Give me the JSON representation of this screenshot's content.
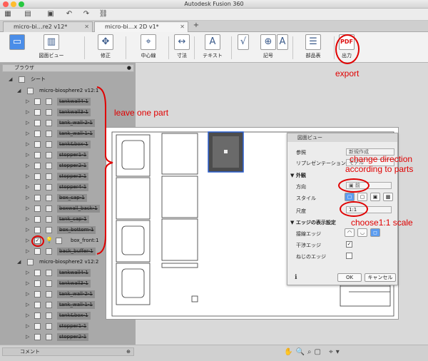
{
  "app": {
    "title": "Autodesk Fusion 360"
  },
  "tabs": [
    {
      "label": "micro-bi…re2 v12*"
    },
    {
      "label": "micro-bi…x 2D v1*"
    }
  ],
  "toolbar": {
    "drawing_view": "図面ビュー",
    "modify": "修正",
    "centerline": "中心線",
    "dimension": "寸法",
    "text": "テキスト",
    "symbol": "記号",
    "parts_list": "部品表",
    "output": "出力"
  },
  "browser": {
    "title": "ブラウザ",
    "sheet": "シート",
    "doc1": "micro-biosphere2 v12:1",
    "doc2": "micro-biosphere2 v12:2",
    "items1": [
      "tankwall4-1",
      "tankwall3-1",
      "tank_wall-2-1",
      "tank_wall-1-1",
      "tank&box-1",
      "stopper1-1",
      "stopper2-1",
      "stopper3-1",
      "stopper4-1",
      "box_cap-1",
      "boxwall_back-1",
      "tank_cap-1",
      "box_bottom-1",
      "box_front:1",
      "back_buffer-1"
    ],
    "items2": [
      "tankwall4-1",
      "tankwall3-1",
      "tank_wall-2-1",
      "tank_wall-1-1",
      "tank&box-1",
      "stopper1-1",
      "stopper2-1"
    ]
  },
  "dialog": {
    "title": "図面ビュー",
    "reference_label": "参照",
    "reference_value": "新規作成",
    "representation_label": "リプレゼンテーション",
    "representation_value": "モデル",
    "appearance_header": "外観",
    "direction_label": "方向",
    "direction_value": "前",
    "style_label": "スタイル",
    "scale_label": "尺度",
    "scale_value": "1:1",
    "edge_header": "エッジの表示設定",
    "tangent_label": "接線エッジ",
    "interference_label": "干渉エッジ",
    "thread_label": "ねじのエッジ",
    "ok": "OK",
    "cancel": "キャンセル"
  },
  "annotations": {
    "export": "export",
    "leave": "leave one part",
    "direction1": "change direction",
    "direction2": "according to parts",
    "scale": "choose1:1 scale"
  },
  "bottom": {
    "comment": "コメント"
  },
  "colors": {
    "annotation": "#e00000",
    "accent": "#3a6fd8"
  }
}
